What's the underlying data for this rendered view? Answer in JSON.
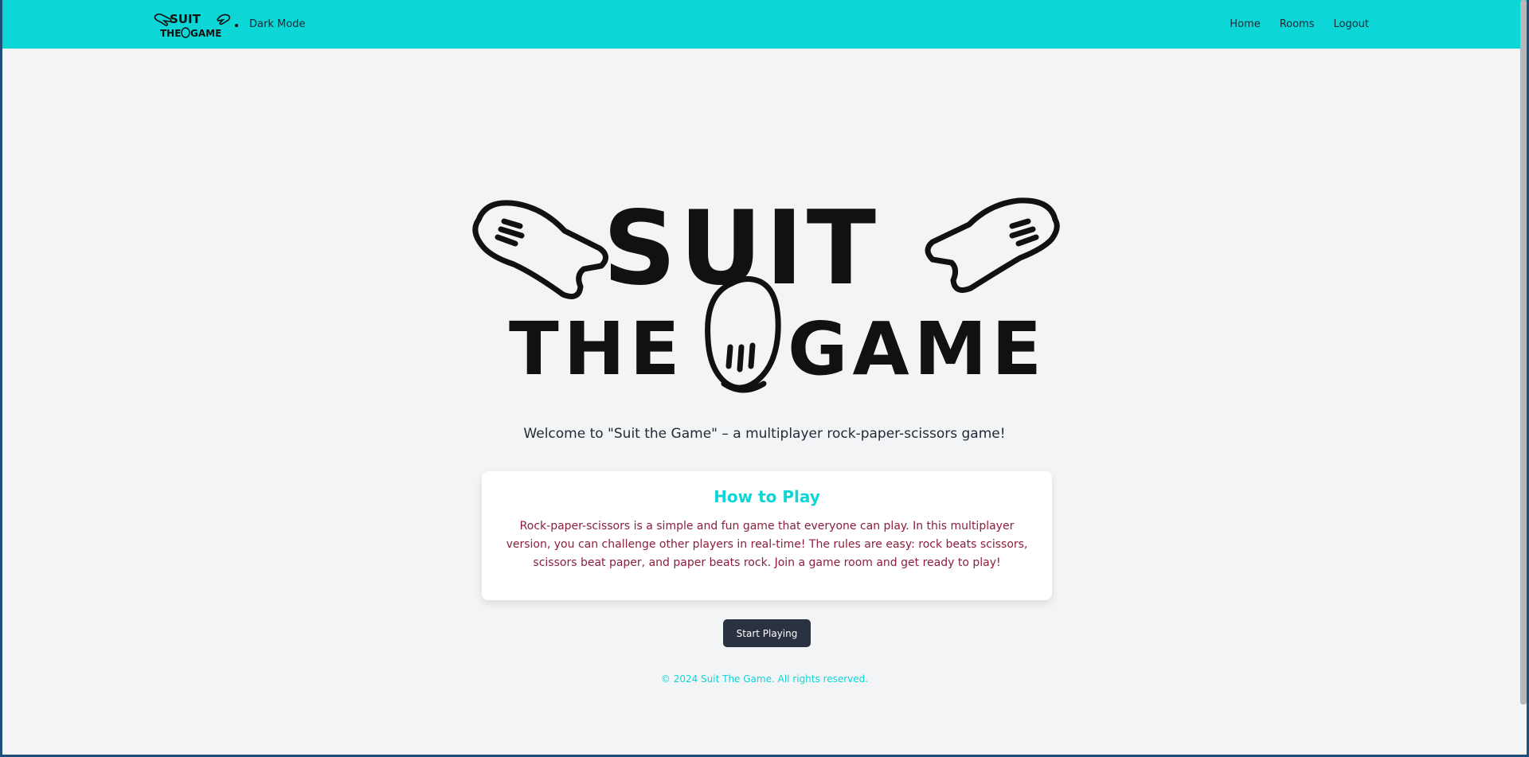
{
  "navbar": {
    "brand_logo_text": "SUIT THE GAME",
    "dark_mode_label": "Dark Mode",
    "links": [
      {
        "label": "Home"
      },
      {
        "label": "Rooms"
      },
      {
        "label": "Logout"
      }
    ],
    "background_color": "#0cd6d6"
  },
  "hero": {
    "logo_text": "SUIT THE GAME",
    "welcome_text": "Welcome to \"Suit the Game\" – a multiplayer rock-paper-scissors game!"
  },
  "how_to_play": {
    "title": "How to Play",
    "body": "Rock-paper-scissors is a simple and fun game that everyone can play. In this multiplayer version, you can challenge other players in real-time! The rules are easy: rock beats scissors, scissors beat paper, and paper beats rock. Join a game room and get ready to play!"
  },
  "start_button_label": "Start Playing",
  "footer_text": "© 2024 Suit The Game. All rights reserved.",
  "colors": {
    "accent": "#0cd6d6",
    "body_text": "#8b1f3d",
    "button": "#2a3140"
  }
}
